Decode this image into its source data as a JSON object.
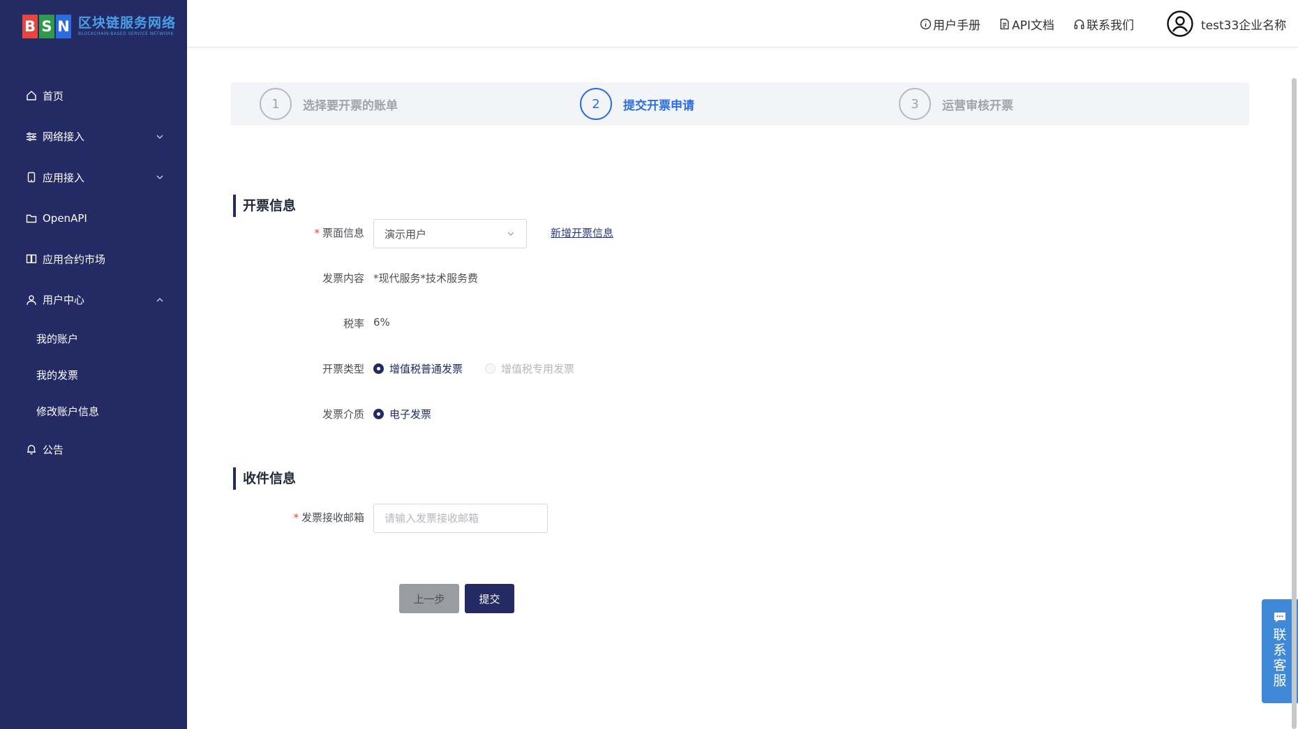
{
  "logo": {
    "letters": [
      "B",
      "S",
      "N"
    ],
    "letter_colors": [
      "#e8453c",
      "#2e9a4c",
      "#2a6de3"
    ],
    "title_cn": "区块链服务网络",
    "title_en": "BLOCKCHAIN-BASED SERVICE NETWORK"
  },
  "sidebar": {
    "items": [
      {
        "label": "首页",
        "icon": "home-icon"
      },
      {
        "label": "网络接入",
        "icon": "sliders-icon",
        "chevron": "down"
      },
      {
        "label": "应用接入",
        "icon": "mobile-icon",
        "chevron": "down"
      },
      {
        "label": "OpenAPI",
        "icon": "folder-icon"
      },
      {
        "label": "应用合约市场",
        "icon": "book-icon"
      },
      {
        "label": "用户中心",
        "icon": "user-icon",
        "chevron": "up"
      }
    ],
    "sub_items": [
      "我的账户",
      "我的发票",
      "修改账户信息"
    ],
    "announcement": {
      "label": "公告",
      "icon": "bell-icon"
    }
  },
  "header": {
    "manual": "用户手册",
    "api_docs": "API文档",
    "contact": "联系我们",
    "user_name": "test33企业名称"
  },
  "steps": [
    {
      "num": "1",
      "label": "选择要开票的账单",
      "active": false
    },
    {
      "num": "2",
      "label": "提交开票申请",
      "active": true
    },
    {
      "num": "3",
      "label": "运营审核开票",
      "active": false
    }
  ],
  "invoice_section": {
    "title": "开票信息",
    "header_label": "票面信息",
    "header_value": "演示用户",
    "add_link": "新增开票信息",
    "content_label": "发票内容",
    "content_value": "*现代服务*技术服务费",
    "rate_label": "税率",
    "rate_value": "6%",
    "type_label": "开票类型",
    "type_options": [
      "增值税普通发票",
      "增值税专用发票"
    ],
    "type_selected": "增值税普通发票",
    "medium_label": "发票介质",
    "medium_options": [
      "电子发票"
    ]
  },
  "shipping_section": {
    "title": "收件信息",
    "email_label": "发票接收邮箱",
    "email_placeholder": "请输入发票接收邮箱",
    "email_value": ""
  },
  "buttons": {
    "prev": "上一步",
    "submit": "提交"
  },
  "float_service": {
    "label": "联系客服"
  },
  "colors": {
    "sidebar_bg": "#232a64",
    "accent": "#2a6de3",
    "primary_button": "#232a64",
    "float": "#4089d9"
  }
}
